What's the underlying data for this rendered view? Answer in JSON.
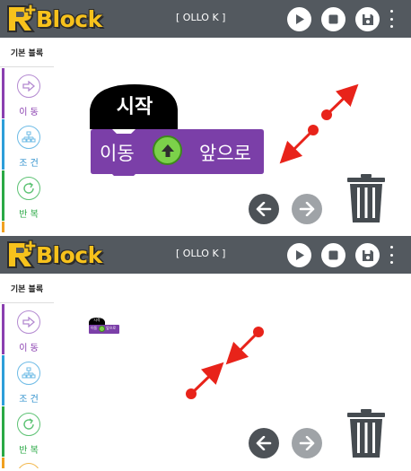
{
  "app": {
    "logo_text": "Block",
    "device_label": "[ OLLO K ]",
    "device_label_2": "[ OLLO K ]"
  },
  "toolbar": {
    "play_icon": "play-icon",
    "stop_icon": "stop-icon",
    "save_icon": "save-icon",
    "menu_icon": "more-vert-icon"
  },
  "sidebar": {
    "header": "기본 블록",
    "items": [
      {
        "label": "이 동",
        "icon": "arrow-right-icon",
        "color": "#8a3fb0"
      },
      {
        "label": "조 건",
        "icon": "tree-icon",
        "color": "#2c9ed9"
      },
      {
        "label": "반 복",
        "icon": "loop-icon",
        "color": "#2aa845"
      }
    ]
  },
  "workspace": {
    "hat_label": "시작",
    "move_label": "이동",
    "direction_label": "앞으로",
    "hat_color": "#000000",
    "move_color": "#7b3fa8",
    "arrow_color": "#7cd14a"
  },
  "controls": {
    "back_icon": "arrow-left-icon",
    "forward_icon": "arrow-right-icon",
    "trash_icon": "trash-icon"
  },
  "annotation": {
    "color": "#e8231a",
    "top_gesture": "pinch-out",
    "bottom_gesture": "pinch-in"
  }
}
